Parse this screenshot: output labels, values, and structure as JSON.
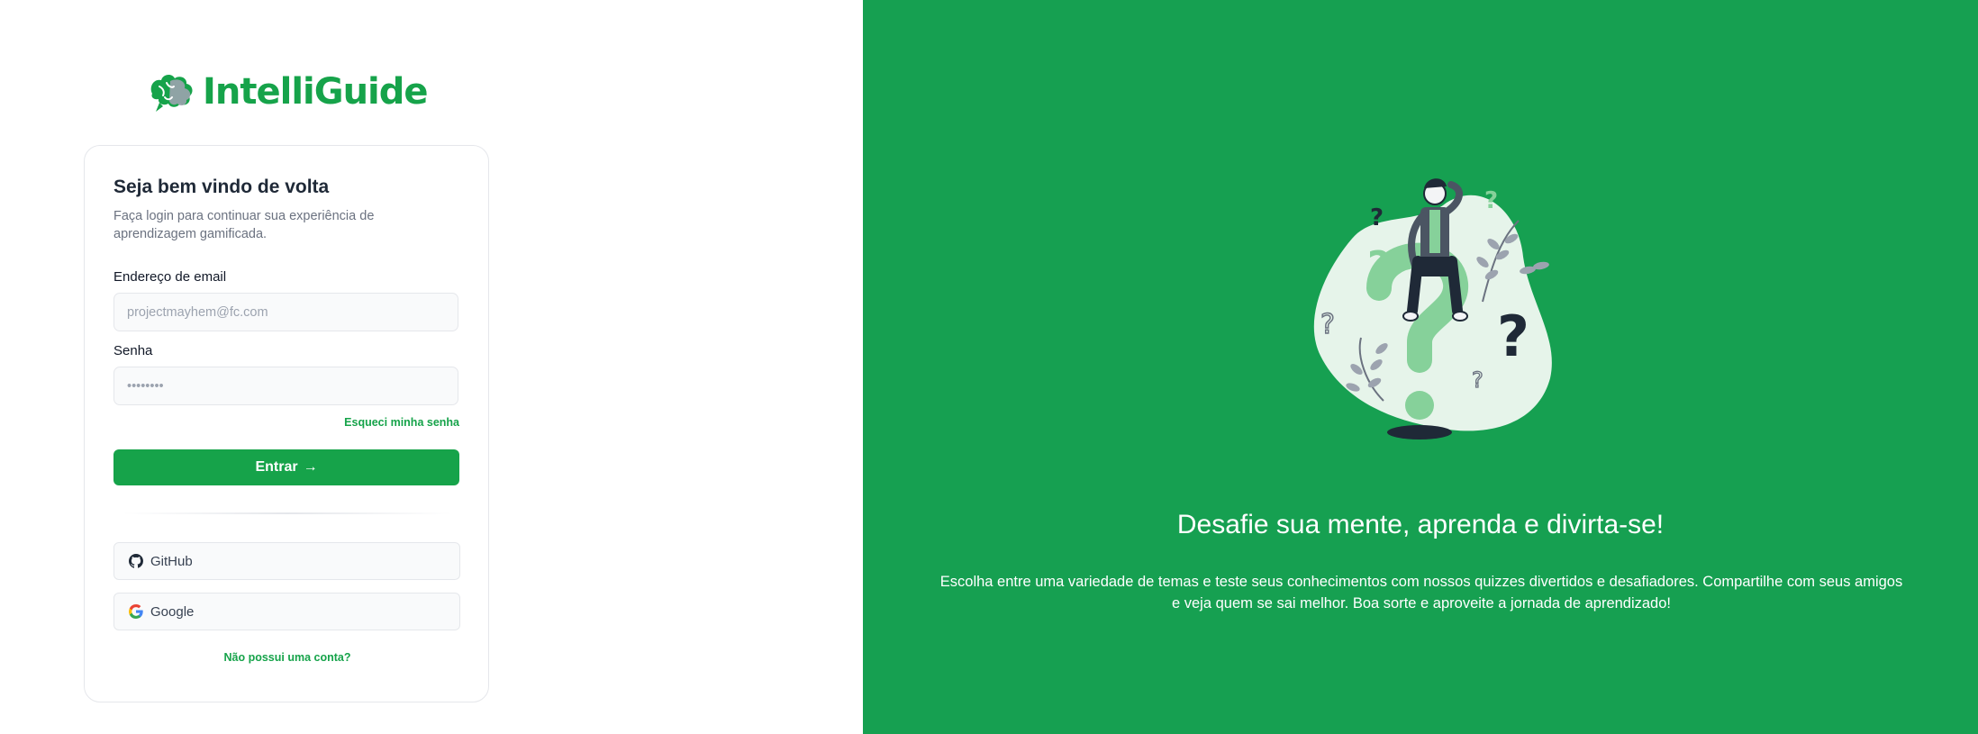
{
  "brand": {
    "name": "IntelliGuide",
    "logo_icon": "brain-icon",
    "color": "#16a34a"
  },
  "login": {
    "title": "Seja bem vindo de volta",
    "subtitle": "Faça login para continuar sua experiência de aprendizagem gamificada.",
    "email_label": "Endereço de email",
    "email_placeholder": "projectmayhem@fc.com",
    "email_value": "",
    "password_label": "Senha",
    "password_placeholder": "••••••••",
    "password_value": "",
    "forgot_password": "Esqueci minha senha",
    "submit_label": "Entrar",
    "submit_icon": "arrow-right-icon",
    "github_label": "GitHub",
    "github_icon": "github-icon",
    "google_label": "Google",
    "google_icon": "google-icon",
    "signup_link": "Não possui uma conta?"
  },
  "hero": {
    "headline": "Desafie sua mente, aprenda e divirta-se!",
    "description": "Escolha entre uma variedade de temas e teste seus conhecimentos com nossos quizzes divertidos e desafiadores. Compartilhe com seus amigos e veja quem se sai melhor. Boa sorte e aproveite a jornada de aprendizado!",
    "illustration": "person-on-question-mark-illustration",
    "background_color": "#16a051"
  },
  "colors": {
    "accent": "#16a34a",
    "card_border": "#e5e7eb",
    "input_bg": "#f9fafb"
  }
}
